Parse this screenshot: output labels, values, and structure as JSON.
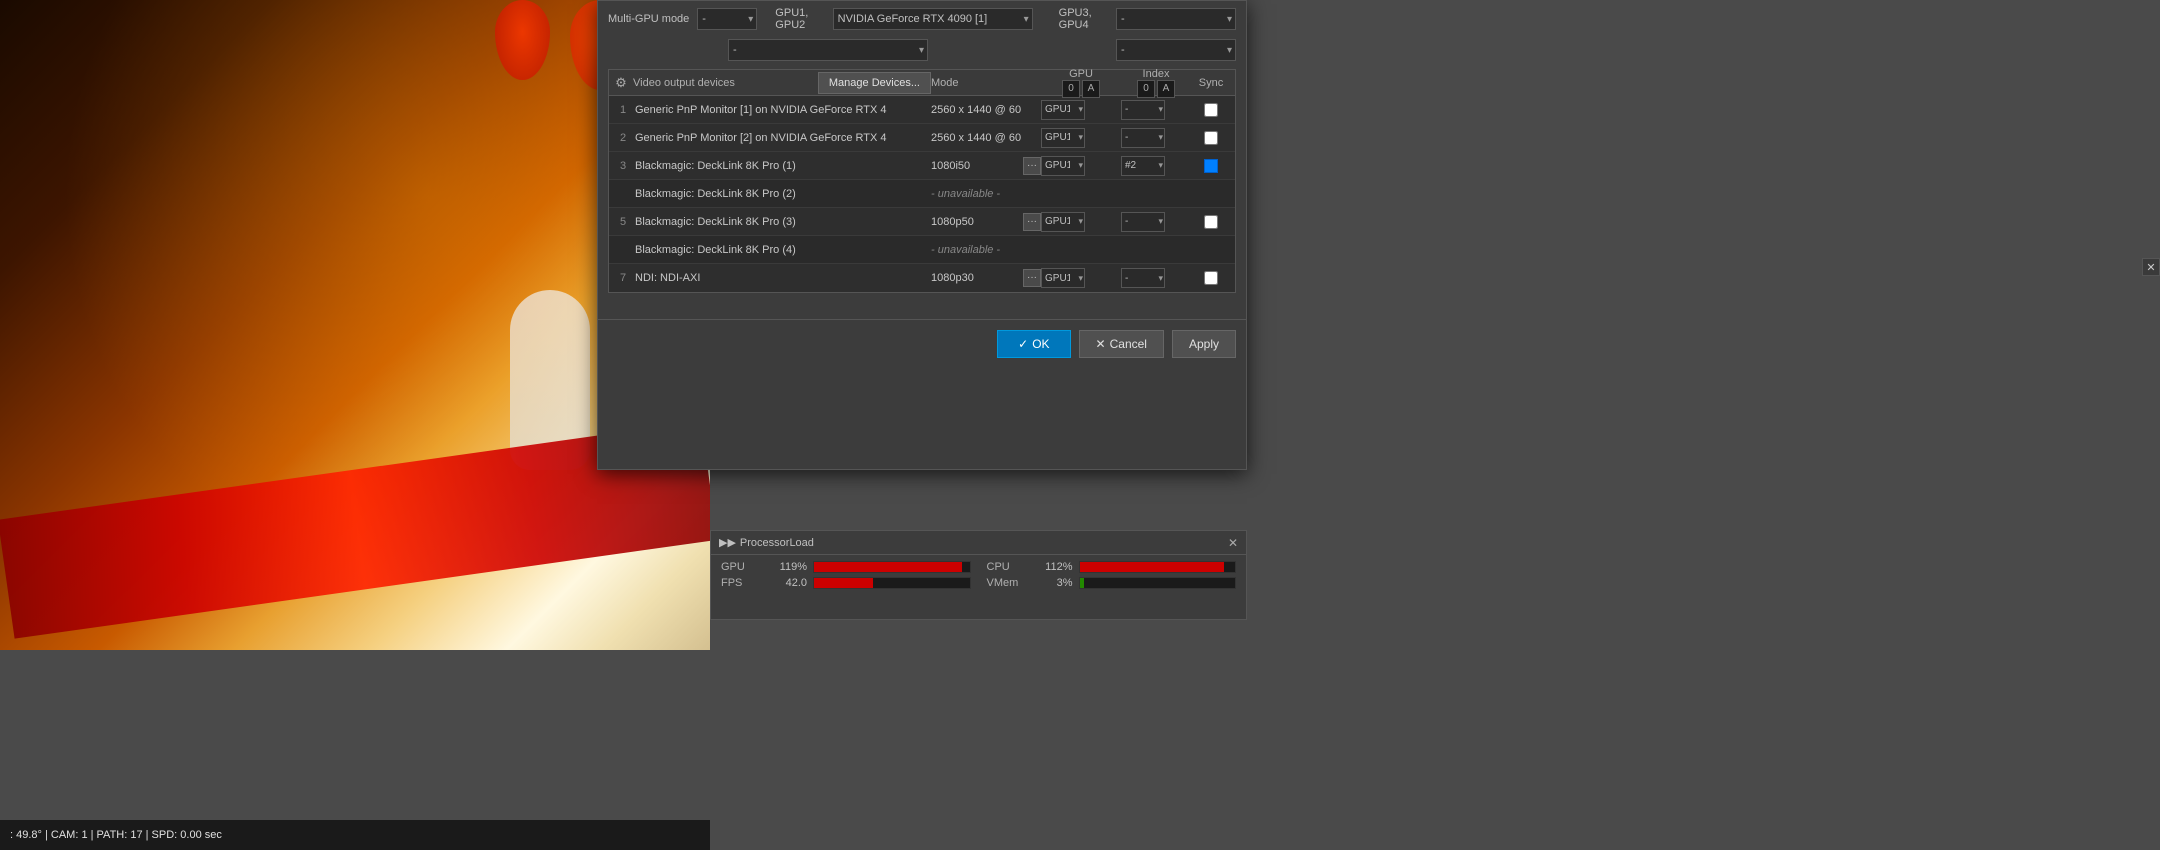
{
  "background": {
    "status_text": ": 49.8° | CAM: 1 | PATH: 17 | SPD: 0.00 sec"
  },
  "dialog": {
    "multi_gpu_label": "Multi-GPU mode",
    "gpu12_label": "GPU1, GPU2",
    "gpu34_label": "GPU3, GPU4",
    "gpu1_gpu2_value": "NVIDIA GeForce RTX 4090 [1]",
    "dash_value": "-",
    "gear_icon": "⚙",
    "video_output_devices_label": "Video output devices",
    "manage_devices_btn": "Manage Devices...",
    "columns": {
      "mode": "Mode",
      "gpu": "GPU",
      "index": "Index",
      "sync": "Sync",
      "gpu_0": "0",
      "gpu_a": "A",
      "index_0": "0",
      "index_a": "A"
    },
    "rows": [
      {
        "num": "1",
        "device": "Generic PnP Monitor [1] on NVIDIA GeForce RTX 4",
        "mode": "2560 x 1440 @ 60",
        "has_dots": false,
        "gpu": "GPU1",
        "index": "-",
        "sync": "checkbox",
        "sync_checked": false,
        "unavailable": false
      },
      {
        "num": "2",
        "device": "Generic PnP Monitor [2] on NVIDIA GeForce RTX 4",
        "mode": "2560 x 1440 @ 60",
        "has_dots": false,
        "gpu": "GPU1",
        "index": "-",
        "sync": "checkbox",
        "sync_checked": false,
        "unavailable": false
      },
      {
        "num": "3",
        "device": "Blackmagic: DeckLink 8K Pro (1)",
        "mode": "1080i50",
        "has_dots": true,
        "gpu": "GPU1",
        "index": "#2",
        "sync": "checkbox",
        "sync_checked": true,
        "sync_blue": true,
        "unavailable": false
      },
      {
        "num": "",
        "device": "Blackmagic: DeckLink 8K Pro (2)",
        "mode": "- unavailable -",
        "has_dots": false,
        "gpu": "",
        "index": "",
        "sync": "",
        "unavailable": true
      },
      {
        "num": "5",
        "device": "Blackmagic: DeckLink 8K Pro (3)",
        "mode": "1080p50",
        "has_dots": true,
        "gpu": "GPU1",
        "index": "-",
        "sync": "checkbox",
        "sync_checked": false,
        "unavailable": false
      },
      {
        "num": "",
        "device": "Blackmagic: DeckLink 8K Pro (4)",
        "mode": "- unavailable -",
        "has_dots": false,
        "gpu": "",
        "index": "",
        "sync": "",
        "unavailable": true
      },
      {
        "num": "7",
        "device": "NDI: NDI-AXI",
        "mode": "1080p30",
        "has_dots": true,
        "gpu": "GPU1",
        "index": "-",
        "sync": "checkbox",
        "sync_checked": false,
        "unavailable": false
      }
    ],
    "footer": {
      "ok_label": "OK",
      "cancel_label": "Cancel",
      "apply_label": "Apply",
      "checkmark": "✓",
      "x_mark": "✕"
    }
  },
  "processor_panel": {
    "title": "ProcessorLoad",
    "close_icon": "✕",
    "arrow_icon": "▶▶",
    "metrics": [
      {
        "label": "GPU",
        "value": "119%",
        "bar_pct": 95,
        "type": "red"
      },
      {
        "label": "FPS",
        "value": "42.0",
        "bar_pct": 38,
        "type": "red"
      }
    ],
    "metrics_right": [
      {
        "label": "CPU",
        "value": "112%",
        "bar_pct": 93,
        "type": "red"
      },
      {
        "label": "VMem",
        "value": "3%",
        "bar_pct": 3,
        "type": "green"
      }
    ]
  }
}
